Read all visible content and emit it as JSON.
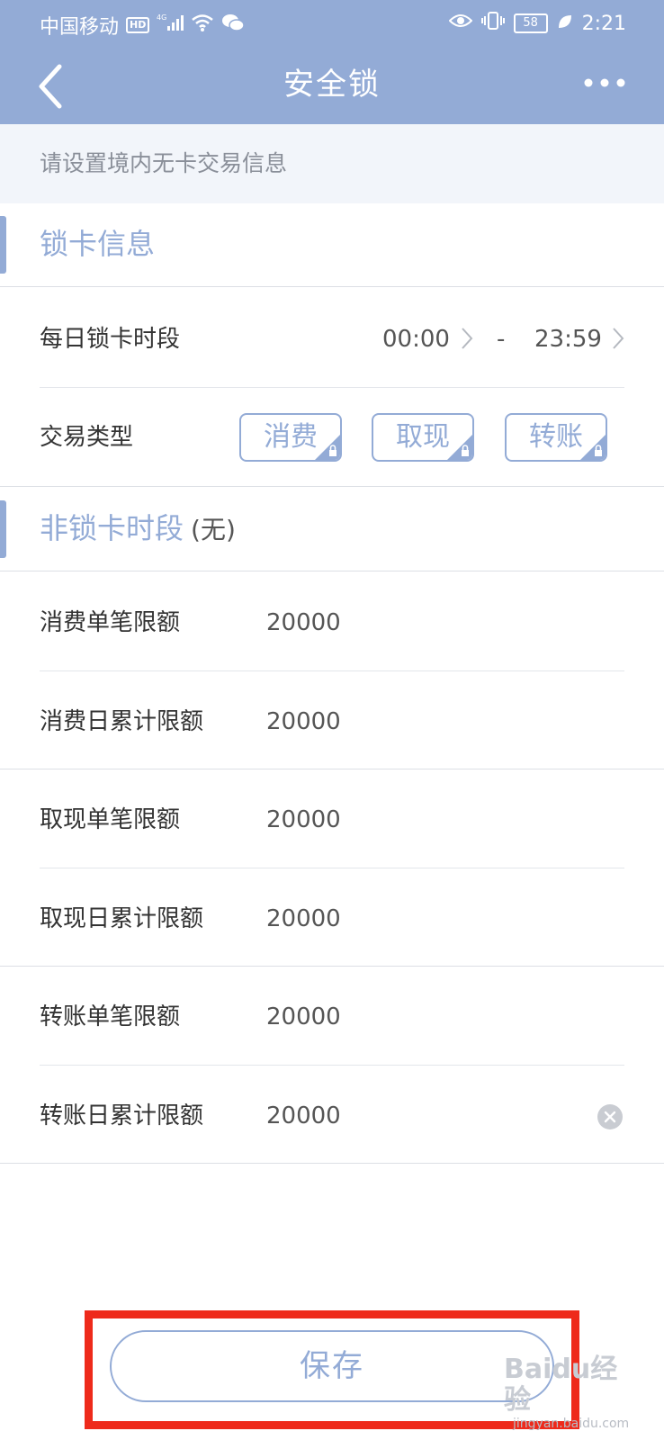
{
  "status_bar": {
    "carrier": "中国移动",
    "hd_badge": "HD",
    "network": "4G",
    "battery": "58",
    "time": "2:21"
  },
  "header": {
    "title": "安全锁",
    "back_icon": "chevron-left-icon",
    "more_icon": "more-dots-icon"
  },
  "notice": "请设置境内无卡交易信息",
  "lock_section": {
    "title": "锁卡信息",
    "period": {
      "label": "每日锁卡时段",
      "start": "00:00",
      "separator": "-",
      "end": "23:59"
    },
    "types": {
      "label": "交易类型",
      "items": [
        "消费",
        "取现",
        "转账"
      ]
    }
  },
  "unlock_section": {
    "title": "非锁卡时段",
    "suffix": "(无)",
    "limits": [
      {
        "label": "消费单笔限额",
        "value": "20000"
      },
      {
        "label": "消费日累计限额",
        "value": "20000"
      },
      {
        "label": "取现单笔限额",
        "value": "20000"
      },
      {
        "label": "取现日累计限额",
        "value": "20000"
      },
      {
        "label": "转账单笔限额",
        "value": "20000"
      },
      {
        "label": "转账日累计限额",
        "value": "20000"
      }
    ]
  },
  "save_button": "保存",
  "watermark": {
    "brand": "Baidu",
    "suffix": "经验",
    "url": "jingyan.baidu.com"
  },
  "colors": {
    "accent": "#93abd6",
    "highlight_frame": "#ee2a1b",
    "notice_bg": "#f2f5fa"
  }
}
